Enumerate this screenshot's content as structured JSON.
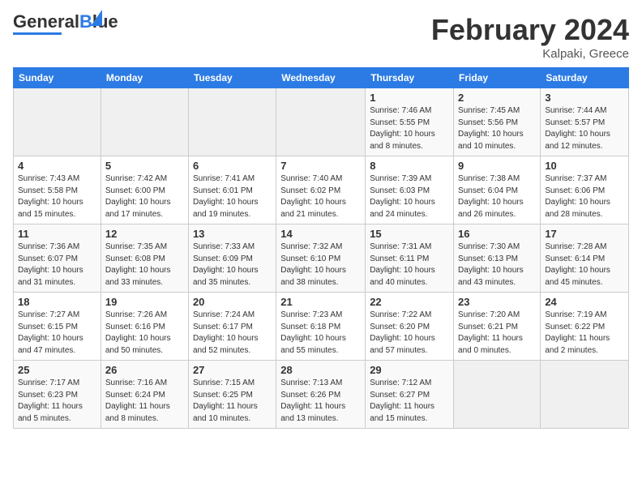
{
  "header": {
    "logo_general": "General",
    "logo_blue": "Blue",
    "month_title": "February 2024",
    "location": "Kalpaki, Greece"
  },
  "columns": [
    "Sunday",
    "Monday",
    "Tuesday",
    "Wednesday",
    "Thursday",
    "Friday",
    "Saturday"
  ],
  "weeks": [
    [
      {
        "day": "",
        "info": ""
      },
      {
        "day": "",
        "info": ""
      },
      {
        "day": "",
        "info": ""
      },
      {
        "day": "",
        "info": ""
      },
      {
        "day": "1",
        "info": "Sunrise: 7:46 AM\nSunset: 5:55 PM\nDaylight: 10 hours\nand 8 minutes."
      },
      {
        "day": "2",
        "info": "Sunrise: 7:45 AM\nSunset: 5:56 PM\nDaylight: 10 hours\nand 10 minutes."
      },
      {
        "day": "3",
        "info": "Sunrise: 7:44 AM\nSunset: 5:57 PM\nDaylight: 10 hours\nand 12 minutes."
      }
    ],
    [
      {
        "day": "4",
        "info": "Sunrise: 7:43 AM\nSunset: 5:58 PM\nDaylight: 10 hours\nand 15 minutes."
      },
      {
        "day": "5",
        "info": "Sunrise: 7:42 AM\nSunset: 6:00 PM\nDaylight: 10 hours\nand 17 minutes."
      },
      {
        "day": "6",
        "info": "Sunrise: 7:41 AM\nSunset: 6:01 PM\nDaylight: 10 hours\nand 19 minutes."
      },
      {
        "day": "7",
        "info": "Sunrise: 7:40 AM\nSunset: 6:02 PM\nDaylight: 10 hours\nand 21 minutes."
      },
      {
        "day": "8",
        "info": "Sunrise: 7:39 AM\nSunset: 6:03 PM\nDaylight: 10 hours\nand 24 minutes."
      },
      {
        "day": "9",
        "info": "Sunrise: 7:38 AM\nSunset: 6:04 PM\nDaylight: 10 hours\nand 26 minutes."
      },
      {
        "day": "10",
        "info": "Sunrise: 7:37 AM\nSunset: 6:06 PM\nDaylight: 10 hours\nand 28 minutes."
      }
    ],
    [
      {
        "day": "11",
        "info": "Sunrise: 7:36 AM\nSunset: 6:07 PM\nDaylight: 10 hours\nand 31 minutes."
      },
      {
        "day": "12",
        "info": "Sunrise: 7:35 AM\nSunset: 6:08 PM\nDaylight: 10 hours\nand 33 minutes."
      },
      {
        "day": "13",
        "info": "Sunrise: 7:33 AM\nSunset: 6:09 PM\nDaylight: 10 hours\nand 35 minutes."
      },
      {
        "day": "14",
        "info": "Sunrise: 7:32 AM\nSunset: 6:10 PM\nDaylight: 10 hours\nand 38 minutes."
      },
      {
        "day": "15",
        "info": "Sunrise: 7:31 AM\nSunset: 6:11 PM\nDaylight: 10 hours\nand 40 minutes."
      },
      {
        "day": "16",
        "info": "Sunrise: 7:30 AM\nSunset: 6:13 PM\nDaylight: 10 hours\nand 43 minutes."
      },
      {
        "day": "17",
        "info": "Sunrise: 7:28 AM\nSunset: 6:14 PM\nDaylight: 10 hours\nand 45 minutes."
      }
    ],
    [
      {
        "day": "18",
        "info": "Sunrise: 7:27 AM\nSunset: 6:15 PM\nDaylight: 10 hours\nand 47 minutes."
      },
      {
        "day": "19",
        "info": "Sunrise: 7:26 AM\nSunset: 6:16 PM\nDaylight: 10 hours\nand 50 minutes."
      },
      {
        "day": "20",
        "info": "Sunrise: 7:24 AM\nSunset: 6:17 PM\nDaylight: 10 hours\nand 52 minutes."
      },
      {
        "day": "21",
        "info": "Sunrise: 7:23 AM\nSunset: 6:18 PM\nDaylight: 10 hours\nand 55 minutes."
      },
      {
        "day": "22",
        "info": "Sunrise: 7:22 AM\nSunset: 6:20 PM\nDaylight: 10 hours\nand 57 minutes."
      },
      {
        "day": "23",
        "info": "Sunrise: 7:20 AM\nSunset: 6:21 PM\nDaylight: 11 hours\nand 0 minutes."
      },
      {
        "day": "24",
        "info": "Sunrise: 7:19 AM\nSunset: 6:22 PM\nDaylight: 11 hours\nand 2 minutes."
      }
    ],
    [
      {
        "day": "25",
        "info": "Sunrise: 7:17 AM\nSunset: 6:23 PM\nDaylight: 11 hours\nand 5 minutes."
      },
      {
        "day": "26",
        "info": "Sunrise: 7:16 AM\nSunset: 6:24 PM\nDaylight: 11 hours\nand 8 minutes."
      },
      {
        "day": "27",
        "info": "Sunrise: 7:15 AM\nSunset: 6:25 PM\nDaylight: 11 hours\nand 10 minutes."
      },
      {
        "day": "28",
        "info": "Sunrise: 7:13 AM\nSunset: 6:26 PM\nDaylight: 11 hours\nand 13 minutes."
      },
      {
        "day": "29",
        "info": "Sunrise: 7:12 AM\nSunset: 6:27 PM\nDaylight: 11 hours\nand 15 minutes."
      },
      {
        "day": "",
        "info": ""
      },
      {
        "day": "",
        "info": ""
      }
    ]
  ]
}
